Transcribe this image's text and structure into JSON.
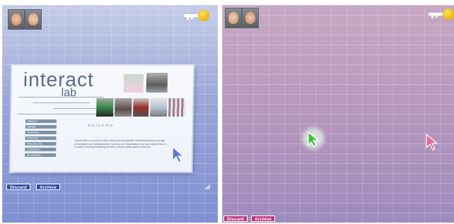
{
  "left_workspace": {
    "users": [
      "user-avatar-1",
      "user-avatar-2"
    ],
    "icon": "key-icon",
    "buttons": {
      "discard": "Discard",
      "archive": "Archive"
    },
    "button_color": "#2f49a8",
    "cursor_color": "#5d79d8",
    "embedded_site": {
      "logo_text": "interact",
      "logo_sub": "lab",
      "welcome": "welcome",
      "nav_items": [
        "ABOUT",
        "NEWS",
        "PAPERS",
        "PEOPLE",
        "PROJECTS",
        "CONTACT",
        "INTRANET"
      ],
      "blurb": "Interact lab is a research centre concerned with possible interactions between people, technologies and representations. Its focus is on developing novel user experiences in a variety of settings including the home, school, public spaces and work."
    }
  },
  "right_workspace": {
    "users": [
      "user-avatar-3",
      "user-avatar-4"
    ],
    "icon": "key-icon",
    "buttons": {
      "discard": "Discard",
      "archive": "Archive"
    },
    "button_color": "#b8357a",
    "center_cursor_color": "#36c23a",
    "side_cursor_color": "#e46a9a"
  }
}
